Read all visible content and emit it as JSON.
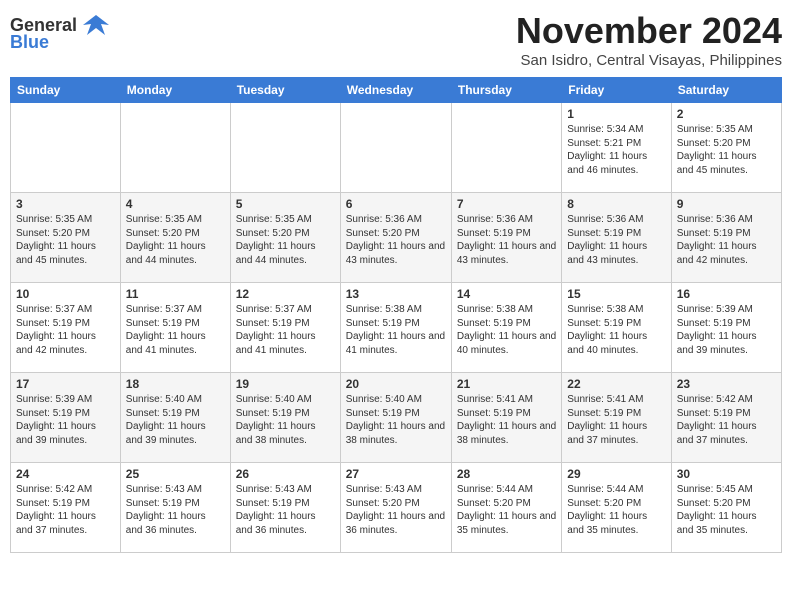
{
  "header": {
    "logo_general": "General",
    "logo_blue": "Blue",
    "month_title": "November 2024",
    "subtitle": "San Isidro, Central Visayas, Philippines"
  },
  "weekdays": [
    "Sunday",
    "Monday",
    "Tuesday",
    "Wednesday",
    "Thursday",
    "Friday",
    "Saturday"
  ],
  "weeks": [
    {
      "days": [
        {
          "num": "",
          "info": ""
        },
        {
          "num": "",
          "info": ""
        },
        {
          "num": "",
          "info": ""
        },
        {
          "num": "",
          "info": ""
        },
        {
          "num": "",
          "info": ""
        },
        {
          "num": "1",
          "info": "Sunrise: 5:34 AM\nSunset: 5:21 PM\nDaylight: 11 hours and 46 minutes."
        },
        {
          "num": "2",
          "info": "Sunrise: 5:35 AM\nSunset: 5:20 PM\nDaylight: 11 hours and 45 minutes."
        }
      ]
    },
    {
      "days": [
        {
          "num": "3",
          "info": "Sunrise: 5:35 AM\nSunset: 5:20 PM\nDaylight: 11 hours and 45 minutes."
        },
        {
          "num": "4",
          "info": "Sunrise: 5:35 AM\nSunset: 5:20 PM\nDaylight: 11 hours and 44 minutes."
        },
        {
          "num": "5",
          "info": "Sunrise: 5:35 AM\nSunset: 5:20 PM\nDaylight: 11 hours and 44 minutes."
        },
        {
          "num": "6",
          "info": "Sunrise: 5:36 AM\nSunset: 5:20 PM\nDaylight: 11 hours and 43 minutes."
        },
        {
          "num": "7",
          "info": "Sunrise: 5:36 AM\nSunset: 5:19 PM\nDaylight: 11 hours and 43 minutes."
        },
        {
          "num": "8",
          "info": "Sunrise: 5:36 AM\nSunset: 5:19 PM\nDaylight: 11 hours and 43 minutes."
        },
        {
          "num": "9",
          "info": "Sunrise: 5:36 AM\nSunset: 5:19 PM\nDaylight: 11 hours and 42 minutes."
        }
      ]
    },
    {
      "days": [
        {
          "num": "10",
          "info": "Sunrise: 5:37 AM\nSunset: 5:19 PM\nDaylight: 11 hours and 42 minutes."
        },
        {
          "num": "11",
          "info": "Sunrise: 5:37 AM\nSunset: 5:19 PM\nDaylight: 11 hours and 41 minutes."
        },
        {
          "num": "12",
          "info": "Sunrise: 5:37 AM\nSunset: 5:19 PM\nDaylight: 11 hours and 41 minutes."
        },
        {
          "num": "13",
          "info": "Sunrise: 5:38 AM\nSunset: 5:19 PM\nDaylight: 11 hours and 41 minutes."
        },
        {
          "num": "14",
          "info": "Sunrise: 5:38 AM\nSunset: 5:19 PM\nDaylight: 11 hours and 40 minutes."
        },
        {
          "num": "15",
          "info": "Sunrise: 5:38 AM\nSunset: 5:19 PM\nDaylight: 11 hours and 40 minutes."
        },
        {
          "num": "16",
          "info": "Sunrise: 5:39 AM\nSunset: 5:19 PM\nDaylight: 11 hours and 39 minutes."
        }
      ]
    },
    {
      "days": [
        {
          "num": "17",
          "info": "Sunrise: 5:39 AM\nSunset: 5:19 PM\nDaylight: 11 hours and 39 minutes."
        },
        {
          "num": "18",
          "info": "Sunrise: 5:40 AM\nSunset: 5:19 PM\nDaylight: 11 hours and 39 minutes."
        },
        {
          "num": "19",
          "info": "Sunrise: 5:40 AM\nSunset: 5:19 PM\nDaylight: 11 hours and 38 minutes."
        },
        {
          "num": "20",
          "info": "Sunrise: 5:40 AM\nSunset: 5:19 PM\nDaylight: 11 hours and 38 minutes."
        },
        {
          "num": "21",
          "info": "Sunrise: 5:41 AM\nSunset: 5:19 PM\nDaylight: 11 hours and 38 minutes."
        },
        {
          "num": "22",
          "info": "Sunrise: 5:41 AM\nSunset: 5:19 PM\nDaylight: 11 hours and 37 minutes."
        },
        {
          "num": "23",
          "info": "Sunrise: 5:42 AM\nSunset: 5:19 PM\nDaylight: 11 hours and 37 minutes."
        }
      ]
    },
    {
      "days": [
        {
          "num": "24",
          "info": "Sunrise: 5:42 AM\nSunset: 5:19 PM\nDaylight: 11 hours and 37 minutes."
        },
        {
          "num": "25",
          "info": "Sunrise: 5:43 AM\nSunset: 5:19 PM\nDaylight: 11 hours and 36 minutes."
        },
        {
          "num": "26",
          "info": "Sunrise: 5:43 AM\nSunset: 5:19 PM\nDaylight: 11 hours and 36 minutes."
        },
        {
          "num": "27",
          "info": "Sunrise: 5:43 AM\nSunset: 5:20 PM\nDaylight: 11 hours and 36 minutes."
        },
        {
          "num": "28",
          "info": "Sunrise: 5:44 AM\nSunset: 5:20 PM\nDaylight: 11 hours and 35 minutes."
        },
        {
          "num": "29",
          "info": "Sunrise: 5:44 AM\nSunset: 5:20 PM\nDaylight: 11 hours and 35 minutes."
        },
        {
          "num": "30",
          "info": "Sunrise: 5:45 AM\nSunset: 5:20 PM\nDaylight: 11 hours and 35 minutes."
        }
      ]
    }
  ]
}
